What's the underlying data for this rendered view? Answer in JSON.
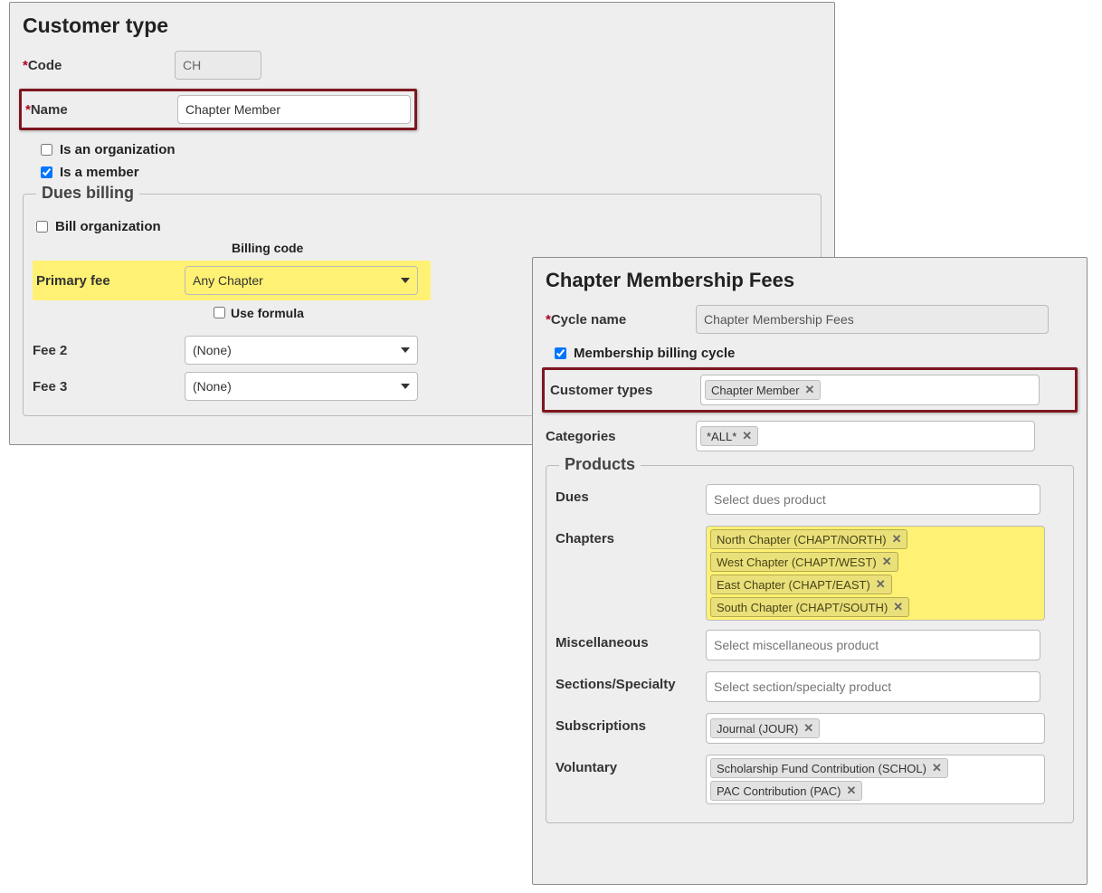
{
  "panelA": {
    "title": "Customer type",
    "code": {
      "label": "Code",
      "value": "CH"
    },
    "name": {
      "label": "Name",
      "value": "Chapter Member"
    },
    "is_org": {
      "label": "Is an organization",
      "checked": false
    },
    "is_member": {
      "label": "Is a member",
      "checked": true
    },
    "dues": {
      "legend": "Dues billing",
      "bill_org": {
        "label": "Bill organization",
        "checked": false
      },
      "billing_code_header": "Billing code",
      "primary_fee": {
        "label": "Primary fee",
        "value": "Any Chapter"
      },
      "use_formula": {
        "label": "Use formula",
        "checked": false
      },
      "fee2": {
        "label": "Fee 2",
        "value": "(None)"
      },
      "fee3": {
        "label": "Fee 3",
        "value": "(None)"
      }
    }
  },
  "panelB": {
    "title": "Chapter Membership Fees",
    "cycle_name": {
      "label": "Cycle name",
      "value": "Chapter Membership Fees"
    },
    "membership_cycle": {
      "label": "Membership billing cycle",
      "checked": true
    },
    "customer_types": {
      "label": "Customer types",
      "chips": [
        "Chapter Member"
      ]
    },
    "categories": {
      "label": "Categories",
      "chips": [
        "*ALL*"
      ]
    },
    "products": {
      "legend": "Products",
      "dues": {
        "label": "Dues",
        "placeholder": "Select dues product"
      },
      "chapters": {
        "label": "Chapters",
        "chips": [
          "North Chapter (CHAPT/NORTH)",
          "West Chapter (CHAPT/WEST)",
          "East Chapter (CHAPT/EAST)",
          "South Chapter (CHAPT/SOUTH)"
        ]
      },
      "misc": {
        "label": "Miscellaneous",
        "placeholder": "Select miscellaneous product"
      },
      "sections": {
        "label": "Sections/Specialty",
        "placeholder": "Select section/specialty product"
      },
      "subscriptions": {
        "label": "Subscriptions",
        "chips": [
          "Journal (JOUR)"
        ]
      },
      "voluntary": {
        "label": "Voluntary",
        "chips": [
          "Scholarship Fund Contribution (SCHOL)",
          "PAC Contribution (PAC)"
        ]
      }
    }
  }
}
